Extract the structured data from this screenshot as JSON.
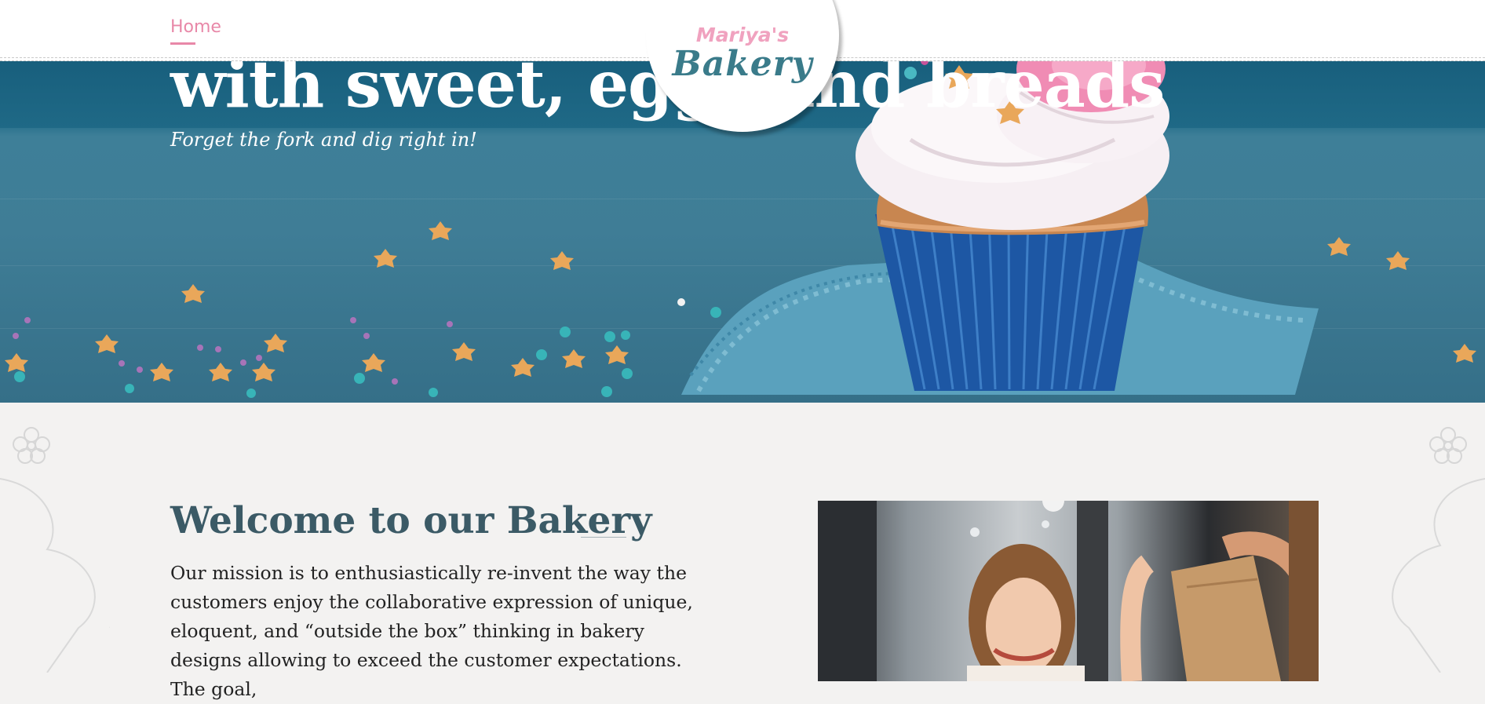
{
  "nav": {
    "home_label": "Home"
  },
  "logo": {
    "script_text": "Mariya's",
    "main_text": "Bakery"
  },
  "hero": {
    "title": "with sweet, eggs and breads",
    "subtitle": "Forget the fork and dig right in!"
  },
  "welcome": {
    "title": "Welcome to our Bakery",
    "text": "Our mission is to enthusiastically re-invent the way the customers enjoy the collaborative expression of unique, eloquent, and “outside the box” thinking in bakery designs allowing to exceed the customer expectations. The goal,"
  },
  "colors": {
    "accent_pink": "#e888a8",
    "logo_teal": "#3a7b8a",
    "heading": "#3b5a66",
    "hero_blue": "#3f7d96"
  }
}
